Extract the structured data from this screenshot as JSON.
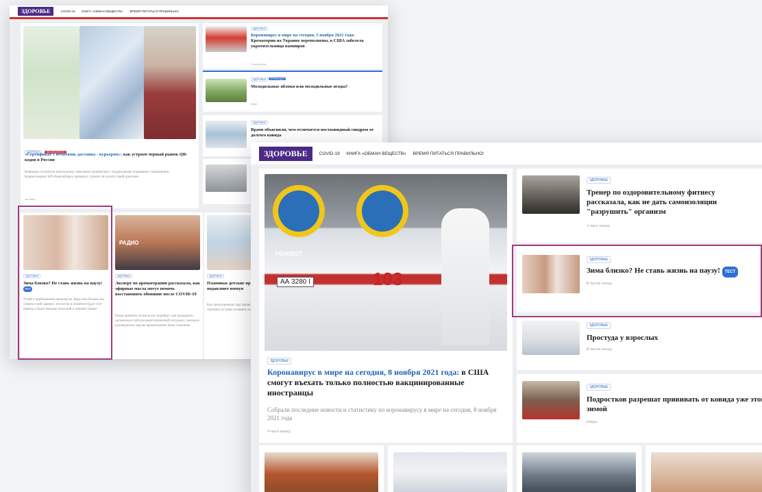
{
  "back": {
    "logo": "ЗДОРОВЬЕ",
    "nav": [
      "COVID-19",
      "КНИГА «ОБМАН ВЕЩЕСТВ»",
      "ВРЕМЯ ПИТАТЬСЯ ПРАВИЛЬНО!"
    ],
    "main": {
      "tags": [
        "ЗДОРОВЬЕ",
        "ЭКСКЛЮЗИВ КП"
      ],
      "title_link": "«Сертификат с печатями, доставка - курьером»:",
      "title_rest": " как устроен черный рынок QR-кодов в России",
      "desc": "Ковидные госпитали наполнились тяжелыми пациентами с поддельными справками о вакцинации. Корреспондент КП-Новосибирск проверил, сложно ли купить такой документ",
      "time": "час назад"
    },
    "side": [
      {
        "tag": "ЗДОРОВЬЕ",
        "title_link": "Коронавирус в мире на сегодня, 5 ноября 2021 года:",
        "title_rest": " Крематории на Украине переполнены, в США заболела укротительница вампиров",
        "time": "5 часов назад"
      },
      {
        "tag": "ЗДОРОВЬЕ",
        "tag2": "ПРОМОЦИЯ",
        "title": "Молодильные яблоки или молодильные ягоды?",
        "time": "вчера"
      },
      {
        "tag": "ЗДОРОВЬЕ",
        "title": "Врачи объяснили, чем отличается постковидный синдром от долгого ковида",
        "time": ""
      }
    ],
    "cards": [
      {
        "tag": "ЗДОРОВЬЕ",
        "title": "Зима близко? Не ставь жизнь на паузу!",
        "pill": "ТЕСТ",
        "desc": "Узнай о приближении менопаузы. Ведь чем больше мы узнаем о ней заранее, тем легче и понятнее будет этот период и будет меньше опасений и лишних тревог"
      },
      {
        "tag": "ЗДОРОВЬЕ",
        "title": "Эксперт по ароматерапии рассказала, как эфирные масла могут помочь восстановить обоняние после COVID-19",
        "desc": "Какие ароматы лучше всего подойдут для поддержки организма в той или иной жизненной ситуации, пояснила руководитель школы ароматерапии Анна Семенова"
      },
      {
        "tag": "ЗДОРОВЬЕ",
        "title": "Плановые детские прививки трене подавляют иммун",
        "desc": "Как пропущенные году прививки и от детских болезне повлиять на пови основное заболева малышей и школь"
      }
    ],
    "photo_text": "РАДИО"
  },
  "front": {
    "logo": "ЗДОРОВЬЕ",
    "nav": [
      "COVID-19",
      "КНИГА «ОБМАН ВЕЩЕСТВ»",
      "ВРЕМЯ ПИТАТЬСЯ ПРАВИЛЬНО!"
    ],
    "main": {
      "tag": "ЗДОРОВЬЕ",
      "title_link": "Коронавирус в мире на сегодня, 8 ноября 2021 года:",
      "title_rest": " в США смогут въехать только полностью вакцинированные иностранцы",
      "desc": "Собрали последние новости и статистику по коронавирусу в мире на сегодня, 8 ноября 2021 года",
      "time": "4 часа назад",
      "plate_left": "PEUGEOT",
      "plate": "АА 3280 I",
      "number": "103"
    },
    "side": [
      {
        "tag": "ЗДОРОВЬЕ",
        "title": "Тренер по оздоровительному фитнесу рассказала, как не дать самоизоляции \"разрушить\" организм",
        "time": "2 часа назад"
      },
      {
        "tag": "ЗДОРОВЬЕ",
        "title": "Зима близко? Не ставь жизнь на паузу!",
        "pill": "ТЕСТ",
        "time": "8 часов назад"
      },
      {
        "tag": "ЗДОРОВЬЕ",
        "title": "Простуда у взрослых",
        "time": "8 часов назад"
      },
      {
        "tag": "ЗДОРОВЬЕ",
        "title": "Подростков разрешат прививать от ковида уже этой зимой",
        "time": "вчера"
      }
    ]
  }
}
